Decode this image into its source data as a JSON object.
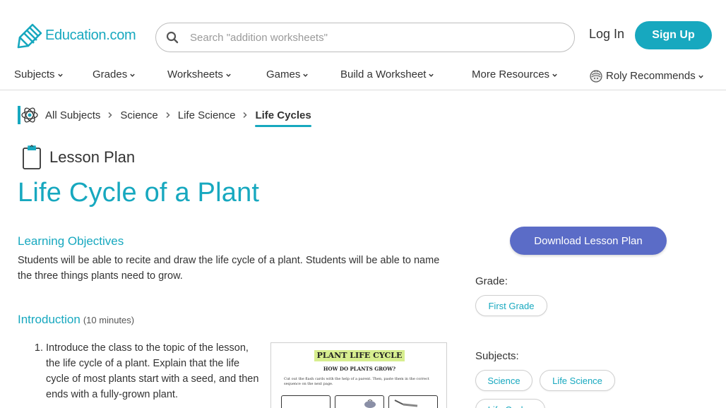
{
  "brand": {
    "name": "Education.com",
    "accent": "#17a8bf",
    "button_blue": "#5b6cc7"
  },
  "search": {
    "placeholder": "Search \"addition worksheets\""
  },
  "auth": {
    "login": "Log In",
    "signup": "Sign Up"
  },
  "nav": {
    "items": [
      {
        "label": "Subjects"
      },
      {
        "label": "Grades"
      },
      {
        "label": "Worksheets"
      },
      {
        "label": "Games"
      },
      {
        "label": "Build a Worksheet"
      },
      {
        "label": "More Resources"
      },
      {
        "label": "Roly Recommends"
      }
    ]
  },
  "breadcrumb": [
    "All Subjects",
    "Science",
    "Life Science",
    "Life Cycles"
  ],
  "resource_type": "Lesson Plan",
  "title": "Life Cycle of a Plant",
  "objectives": {
    "heading": "Learning Objectives",
    "text": "Students will be able to recite and draw the life cycle of a plant. Students will be able to name the three things plants need to grow."
  },
  "introduction": {
    "heading": "Introduction",
    "duration": "(10 minutes)",
    "steps": [
      "Introduce the class to the topic of the lesson, the life cycle of a plant. Explain that the life cycle of most plants start with a seed, and then ends with a fully-grown plant."
    ]
  },
  "worksheet": {
    "title": "PLANT LIFE CYCLE",
    "subtitle": "HOW DO PLANTS GROW?",
    "instructions": "Cut out the flash cards with the help of a parent. Then, paste them in the correct sequence on the next page."
  },
  "sidebar": {
    "download": "Download Lesson Plan",
    "grade_label": "Grade:",
    "grades": [
      "First Grade"
    ],
    "subjects_label": "Subjects:",
    "subjects": [
      "Science",
      "Life Science",
      "Life Cycles"
    ]
  }
}
